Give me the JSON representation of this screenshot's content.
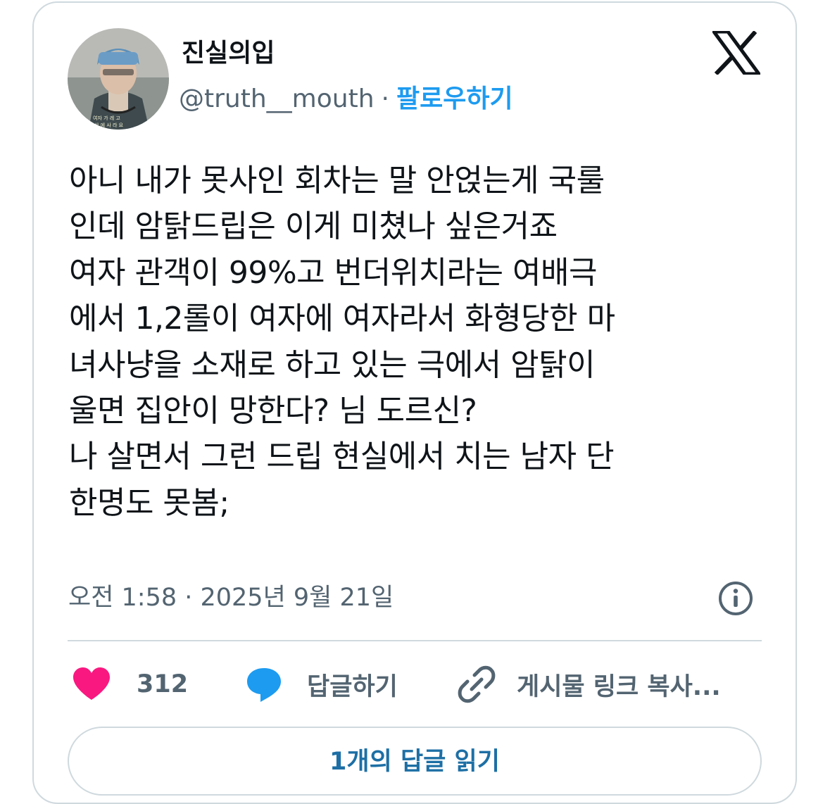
{
  "author": {
    "display_name": "진실의입",
    "handle": "@truth__mouth",
    "separator": "·",
    "follow_label": "팔로우하기",
    "avatar_caption": [
      "여자 가 레 고",
      "삼 에 사 라 요"
    ]
  },
  "brand_icon": "x-logo-icon",
  "tweet": {
    "lines": [
      "아니 내가 못사인 회차는 말 안얹는게 국룰",
      "인데 암탉드립은 이게 미쳤나 싶은거죠",
      "여자 관객이 99%고 번더위치라는 여배극",
      "에서 1,2롤이 여자에 여자라서 화형당한 마",
      "녀사냥을 소재로 하고 있는 극에서 암탉이",
      "울면 집안이 망한다? 님 도르신?",
      "나 살면서 그런 드립 현실에서 치는 남자 단",
      "한명도 못봄;"
    ],
    "timestamp": "오전 1:58 · 2025년 9월 21일"
  },
  "actions": {
    "like_count": "312",
    "reply_label": "답글하기",
    "copy_label": "게시물 링크 복사..."
  },
  "read_replies_label": "1개의 답글 읽기",
  "colors": {
    "accent": "#1d9bf0",
    "like": "#f91880",
    "muted": "#536471",
    "border": "#cfd9de"
  }
}
